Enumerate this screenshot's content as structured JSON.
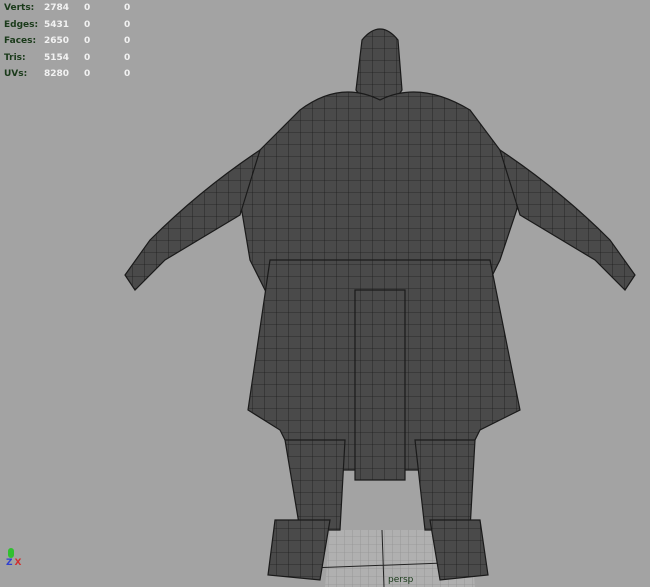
{
  "stats": [
    {
      "label": "Verts:",
      "value": "2784",
      "sel1": "0",
      "sel2": "0"
    },
    {
      "label": "Edges:",
      "value": "5431",
      "sel1": "0",
      "sel2": "0"
    },
    {
      "label": "Faces:",
      "value": "2650",
      "sel1": "0",
      "sel2": "0"
    },
    {
      "label": "Tris:",
      "value": "5154",
      "sel1": "0",
      "sel2": "0"
    },
    {
      "label": "UVs:",
      "value": "8280",
      "sel1": "0",
      "sel2": "0"
    }
  ],
  "camera_label": "persp",
  "axis": {
    "z": "Z",
    "x": "X",
    "colors": {
      "x": "#d03030",
      "y": "#30c030",
      "z": "#3040d0"
    }
  }
}
